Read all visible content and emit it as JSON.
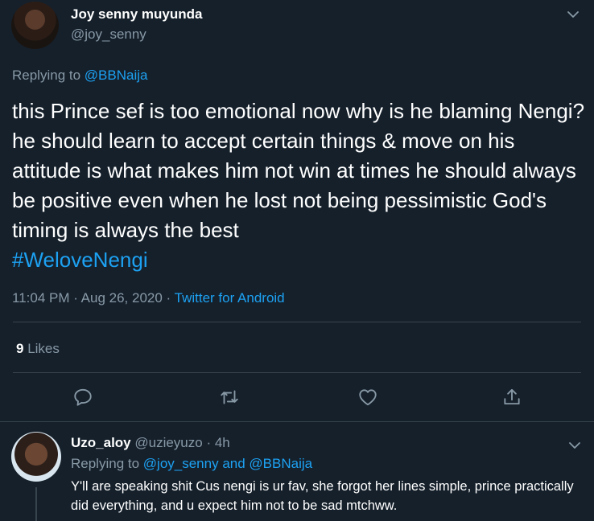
{
  "tweet": {
    "author_name": "Joy senny muyunda",
    "author_handle": "@joy_senny",
    "replying_prefix": "Replying to ",
    "replying_to": "@BBNaija",
    "text": "this Prince sef is too emotional now why is he blaming Nengi? he should learn to accept certain things & move on his attitude is what makes him not win at times he should always be positive even when he lost not being pessimistic God's timing is always the best",
    "hashtag": "#WeloveNengi",
    "timestamp": "11:04 PM · Aug 26, 2020 · ",
    "source": "Twitter for Android",
    "likes_count": "9",
    "likes_label": " Likes",
    "icons": [
      "reply-icon",
      "retweet-icon",
      "like-icon",
      "share-icon"
    ],
    "menu_icon": "chevron-down-icon"
  },
  "reply": {
    "author_name": "Uzo_aloy",
    "meta": " @uzieyuzo · 4h",
    "replying_prefix": "Replying to ",
    "replying_to_1": "@joy_senny",
    "replying_and": " and ",
    "replying_to_2": "@BBNaija",
    "text": "Y'll are speaking shit Cus nengi is ur fav, she forgot her lines simple, prince practically did everything, and u expect him not to be sad mtchww.",
    "menu_icon": "chevron-down-icon"
  },
  "colors": {
    "background": "#15202b",
    "accent": "#1da1f2",
    "muted": "#8899a6",
    "divider": "#38444d"
  }
}
